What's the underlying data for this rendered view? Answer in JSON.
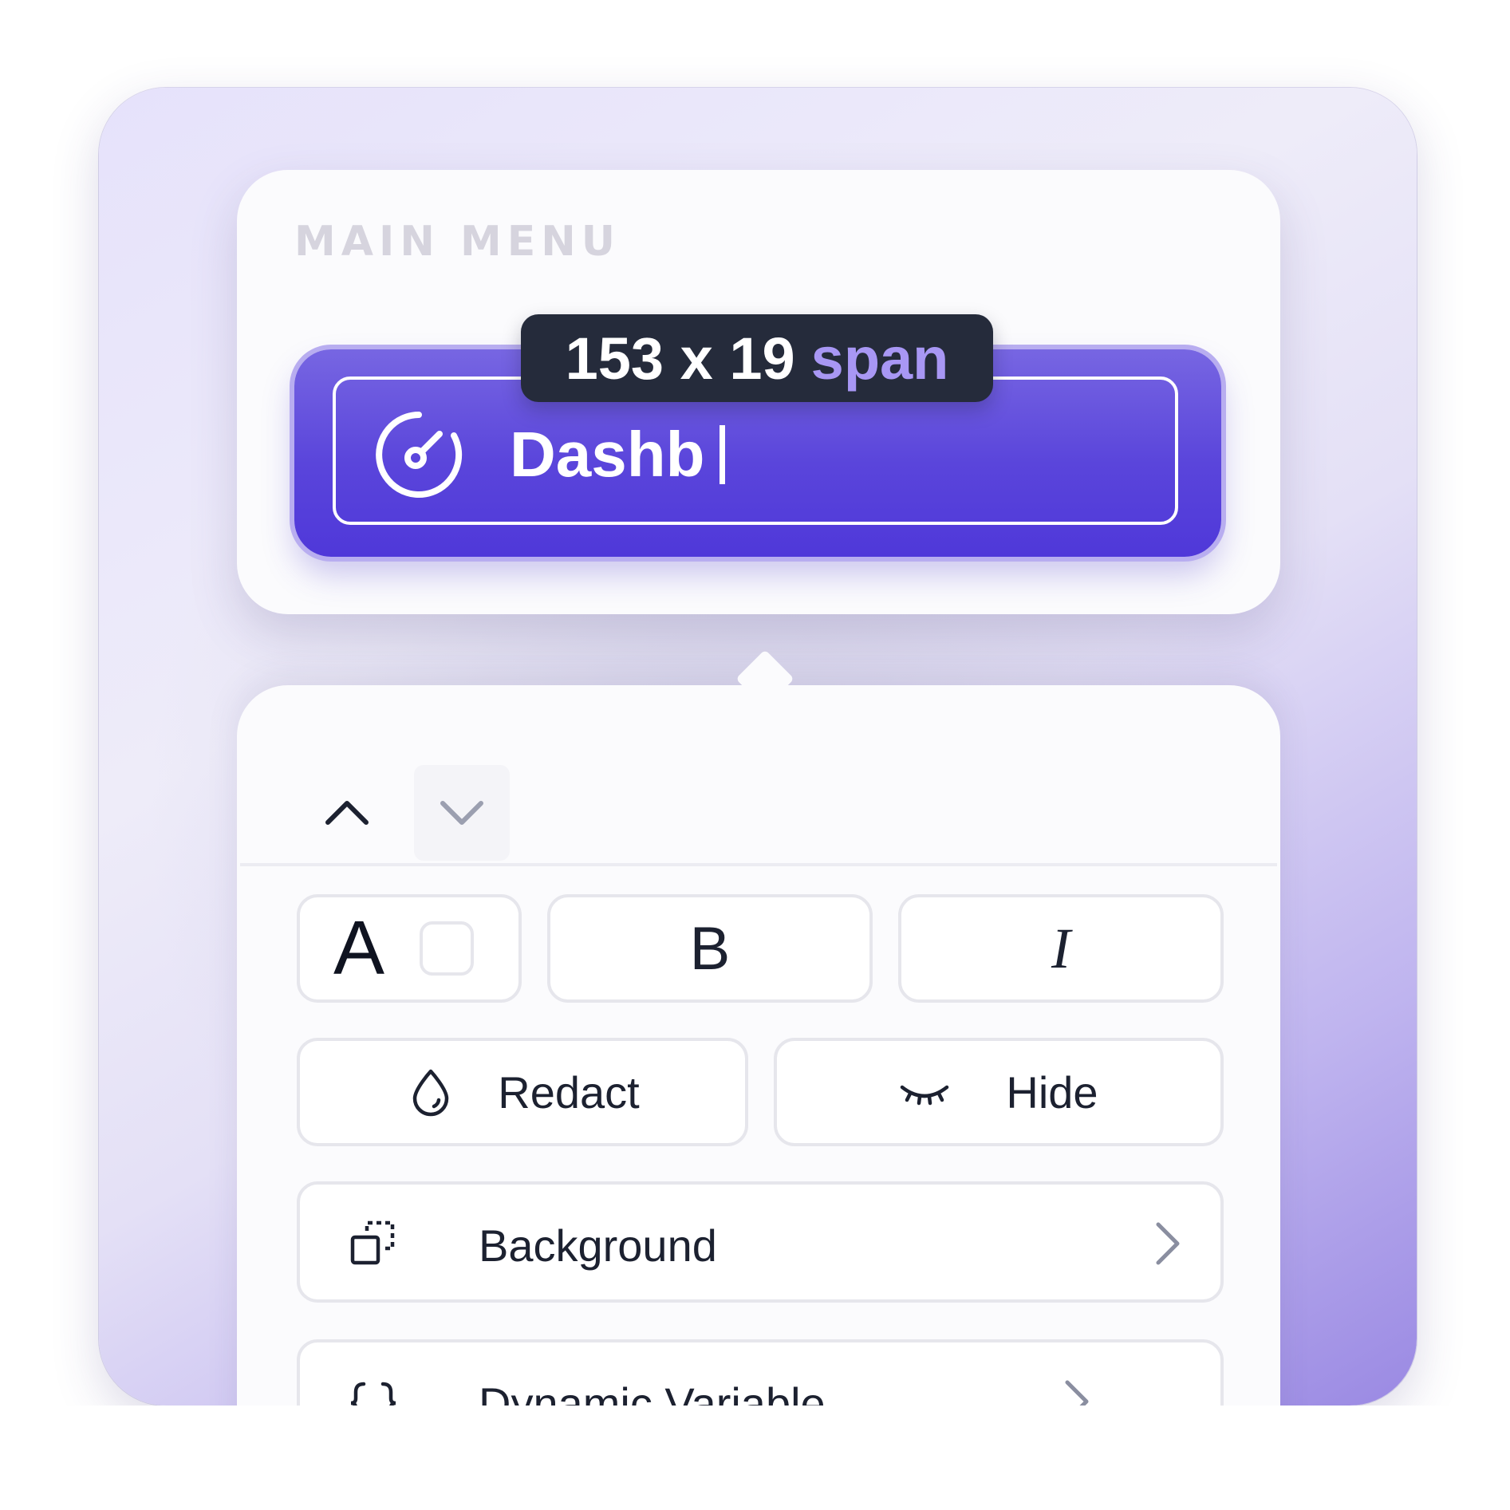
{
  "menu": {
    "section_label": "MAIN MENU",
    "selected_item": {
      "label_typed": "Dashb",
      "icon": "dashboard-gauge-icon"
    }
  },
  "inspector_tooltip": {
    "dimensions": "153 x 19",
    "tag": "span"
  },
  "toolbar": {
    "up_icon": "chevron-up-icon",
    "down_icon": "chevron-down-icon",
    "font_color_glyph": "A",
    "bold_glyph": "B",
    "italic_glyph": "I",
    "redact_label": "Redact",
    "redact_icon": "droplet-icon",
    "hide_label": "Hide",
    "hide_icon": "eye-closed-icon",
    "rows": [
      {
        "label": "Background",
        "icon": "background-layers-icon"
      },
      {
        "label": "Dynamic Variable",
        "icon": "curly-braces-icon"
      }
    ]
  },
  "colors": {
    "accent": "#5a45db",
    "tag_highlight": "#a897f4",
    "tooltip_bg": "#252b3b",
    "label_muted": "#d6d4de"
  }
}
